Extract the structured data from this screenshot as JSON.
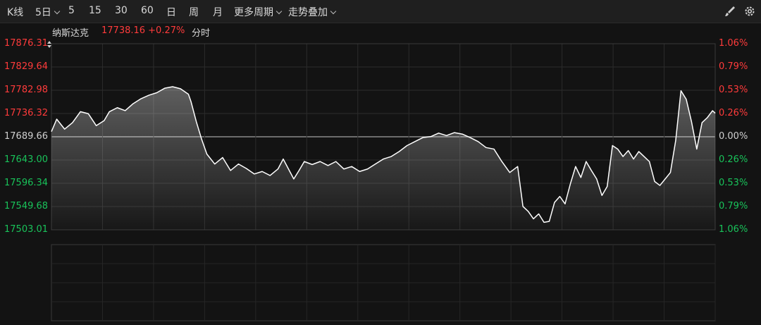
{
  "toolbar": {
    "items": [
      {
        "label": "K线"
      },
      {
        "label": "5日",
        "dropdown": true
      },
      {
        "label": "5"
      },
      {
        "label": "15"
      },
      {
        "label": "30"
      },
      {
        "label": "60"
      },
      {
        "label": "日"
      },
      {
        "label": "周"
      },
      {
        "label": "月"
      },
      {
        "label": "更多周期",
        "dropdown": true
      },
      {
        "label": "走势叠加",
        "dropdown": true
      }
    ],
    "icons": [
      "brush-icon",
      "settings-icon"
    ]
  },
  "info": {
    "name": "纳斯达克",
    "price_change": "17738.16 +0.27%",
    "mode": "分时"
  },
  "colors": {
    "up": "#ff3b3b",
    "down": "#19c35a",
    "neutral": "#d0d0d0",
    "line": "#ffffff"
  },
  "chart_data": {
    "type": "area",
    "title": "",
    "left_axis_ticks": [
      "17876.31",
      "17829.64",
      "17782.98",
      "17736.32",
      "17689.66",
      "17643.00",
      "17596.34",
      "17549.68",
      "17503.01"
    ],
    "right_axis_ticks": [
      "1.06%",
      "0.79%",
      "0.53%",
      "0.26%",
      "0.00%",
      "0.26%",
      "0.53%",
      "0.79%",
      "1.06%"
    ],
    "ylim": [
      17503.01,
      17876.31
    ],
    "baseline": 17689.66,
    "days": 5,
    "grid": true,
    "points": [
      [
        0,
        17700
      ],
      [
        2,
        17725
      ],
      [
        5,
        17705
      ],
      [
        8,
        17718
      ],
      [
        11,
        17740
      ],
      [
        14,
        17736
      ],
      [
        17,
        17712
      ],
      [
        20,
        17722
      ],
      [
        22,
        17740
      ],
      [
        25,
        17748
      ],
      [
        28,
        17742
      ],
      [
        31,
        17756
      ],
      [
        34,
        17766
      ],
      [
        37,
        17773
      ],
      [
        40,
        17778
      ],
      [
        43,
        17787
      ],
      [
        46,
        17790
      ],
      [
        49,
        17786
      ],
      [
        52,
        17775
      ],
      [
        53,
        17760
      ],
      [
        55,
        17720
      ],
      [
        57,
        17685
      ],
      [
        59,
        17655
      ],
      [
        62,
        17635
      ],
      [
        65,
        17648
      ],
      [
        68,
        17622
      ],
      [
        71,
        17635
      ],
      [
        74,
        17626
      ],
      [
        77,
        17615
      ],
      [
        80,
        17620
      ],
      [
        83,
        17612
      ],
      [
        86,
        17625
      ],
      [
        88,
        17645
      ],
      [
        90,
        17625
      ],
      [
        92,
        17605
      ],
      [
        94,
        17622
      ],
      [
        96,
        17640
      ],
      [
        99,
        17634
      ],
      [
        102,
        17640
      ],
      [
        105,
        17632
      ],
      [
        108,
        17640
      ],
      [
        111,
        17625
      ],
      [
        114,
        17630
      ],
      [
        117,
        17620
      ],
      [
        120,
        17625
      ],
      [
        123,
        17635
      ],
      [
        126,
        17645
      ],
      [
        129,
        17650
      ],
      [
        132,
        17660
      ],
      [
        135,
        17672
      ],
      [
        138,
        17680
      ],
      [
        141,
        17688
      ],
      [
        144,
        17690
      ],
      [
        147,
        17697
      ],
      [
        150,
        17692
      ],
      [
        153,
        17698
      ],
      [
        156,
        17695
      ],
      [
        159,
        17688
      ],
      [
        162,
        17680
      ],
      [
        165,
        17668
      ],
      [
        168,
        17665
      ],
      [
        171,
        17640
      ],
      [
        174,
        17618
      ],
      [
        177,
        17630
      ],
      [
        179,
        17550
      ],
      [
        181,
        17540
      ],
      [
        183,
        17525
      ],
      [
        185,
        17535
      ],
      [
        187,
        17518
      ],
      [
        189,
        17520
      ],
      [
        191,
        17558
      ],
      [
        193,
        17570
      ],
      [
        195,
        17555
      ],
      [
        197,
        17595
      ],
      [
        199,
        17630
      ],
      [
        201,
        17608
      ],
      [
        203,
        17640
      ],
      [
        205,
        17622
      ],
      [
        207,
        17605
      ],
      [
        209,
        17572
      ],
      [
        211,
        17590
      ],
      [
        213,
        17672
      ],
      [
        215,
        17665
      ],
      [
        217,
        17650
      ],
      [
        219,
        17662
      ],
      [
        221,
        17645
      ],
      [
        223,
        17660
      ],
      [
        225,
        17650
      ],
      [
        227,
        17640
      ],
      [
        229,
        17600
      ],
      [
        231,
        17592
      ],
      [
        233,
        17605
      ],
      [
        235,
        17618
      ],
      [
        237,
        17682
      ],
      [
        239,
        17782
      ],
      [
        241,
        17765
      ],
      [
        243,
        17720
      ],
      [
        245,
        17665
      ],
      [
        247,
        17718
      ],
      [
        249,
        17728
      ],
      [
        251,
        17742
      ],
      [
        252,
        17737
      ]
    ]
  }
}
